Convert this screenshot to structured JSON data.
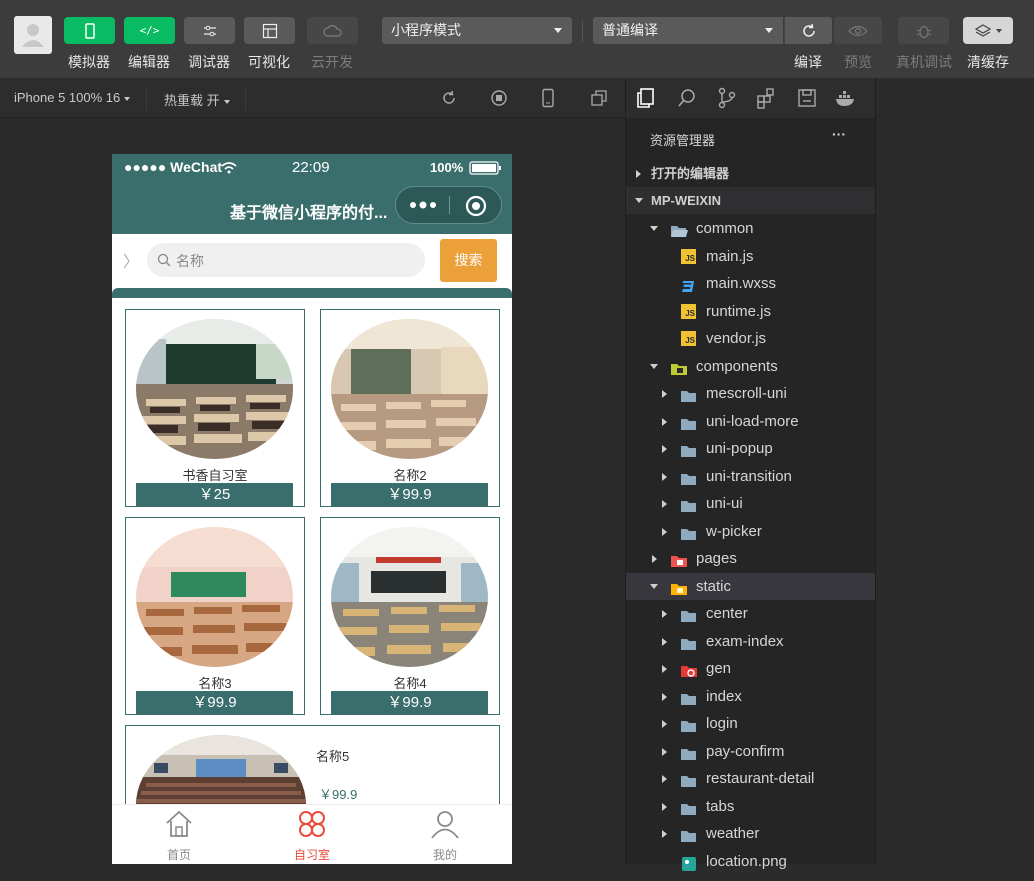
{
  "toolbar": {
    "buttons": [
      {
        "label": "模拟器",
        "icon": "phone-icon",
        "style": "green"
      },
      {
        "label": "编辑器",
        "icon": "code-icon",
        "style": "green"
      },
      {
        "label": "调试器",
        "icon": "debug-sliders-icon",
        "style": "gray"
      },
      {
        "label": "可视化",
        "icon": "layout-icon",
        "style": "gray"
      },
      {
        "label": "云开发",
        "icon": "cloud-icon",
        "style": "disabled"
      }
    ],
    "mode_select": "小程序模式",
    "compile_select": "普通编译",
    "right_actions": [
      {
        "label": "编译",
        "icon": "refresh-icon",
        "enabled": true
      },
      {
        "label": "预览",
        "icon": "eye-icon",
        "enabled": false
      },
      {
        "label": "真机调试",
        "icon": "bug-icon",
        "enabled": false
      },
      {
        "label": "清缓存",
        "icon": "layers-icon",
        "enabled": true
      }
    ]
  },
  "simulator": {
    "device": "iPhone 5 100% 16",
    "hot_reload": "热重载 开"
  },
  "phone": {
    "status": {
      "carrier": "●●●●● WeChat",
      "time": "22:09",
      "battery": "100%"
    },
    "nav_title": "基于微信小程序的付...",
    "search_placeholder": "名称",
    "search_button": "搜索",
    "rooms": [
      {
        "name": "书香自习室",
        "price": "￥25"
      },
      {
        "name": "名称2",
        "price": "￥99.9"
      },
      {
        "name": "名称3",
        "price": "￥99.9"
      },
      {
        "name": "名称4",
        "price": "￥99.9"
      },
      {
        "name": "名称5",
        "price": "￥99.9"
      }
    ],
    "tabs": [
      {
        "label": "首页",
        "active": false
      },
      {
        "label": "自习室",
        "active": true
      },
      {
        "label": "我的",
        "active": false
      }
    ]
  },
  "explorer": {
    "title": "资源管理器",
    "more": "···",
    "open_editors": "打开的编辑器",
    "project": "MP-WEIXIN",
    "tree": [
      {
        "label": "common",
        "depth": 1,
        "kind": "folder-open",
        "expanded": true
      },
      {
        "label": "main.js",
        "depth": 2,
        "kind": "js"
      },
      {
        "label": "main.wxss",
        "depth": 2,
        "kind": "css"
      },
      {
        "label": "runtime.js",
        "depth": 2,
        "kind": "js"
      },
      {
        "label": "vendor.js",
        "depth": 2,
        "kind": "js"
      },
      {
        "label": "components",
        "depth": 1,
        "kind": "folder-components",
        "expanded": true
      },
      {
        "label": "mescroll-uni",
        "depth": 2,
        "kind": "folder"
      },
      {
        "label": "uni-load-more",
        "depth": 2,
        "kind": "folder"
      },
      {
        "label": "uni-popup",
        "depth": 2,
        "kind": "folder"
      },
      {
        "label": "uni-transition",
        "depth": 2,
        "kind": "folder"
      },
      {
        "label": "uni-ui",
        "depth": 2,
        "kind": "folder"
      },
      {
        "label": "w-picker",
        "depth": 2,
        "kind": "folder"
      },
      {
        "label": "pages",
        "depth": 1,
        "kind": "folder-pages",
        "expanded": false
      },
      {
        "label": "static",
        "depth": 1,
        "kind": "folder-static",
        "expanded": true,
        "selected": true
      },
      {
        "label": "center",
        "depth": 2,
        "kind": "folder"
      },
      {
        "label": "exam-index",
        "depth": 2,
        "kind": "folder"
      },
      {
        "label": "gen",
        "depth": 2,
        "kind": "folder-gen"
      },
      {
        "label": "index",
        "depth": 2,
        "kind": "folder"
      },
      {
        "label": "login",
        "depth": 2,
        "kind": "folder"
      },
      {
        "label": "pay-confirm",
        "depth": 2,
        "kind": "folder"
      },
      {
        "label": "restaurant-detail",
        "depth": 2,
        "kind": "folder"
      },
      {
        "label": "tabs",
        "depth": 2,
        "kind": "folder"
      },
      {
        "label": "weather",
        "depth": 2,
        "kind": "folder"
      },
      {
        "label": "location.png",
        "depth": 2,
        "kind": "image"
      }
    ]
  },
  "colors": {
    "teal": "#3a6e6c",
    "orange": "#eca039",
    "green": "#09bb62",
    "tab_active": "#e94b3c"
  }
}
